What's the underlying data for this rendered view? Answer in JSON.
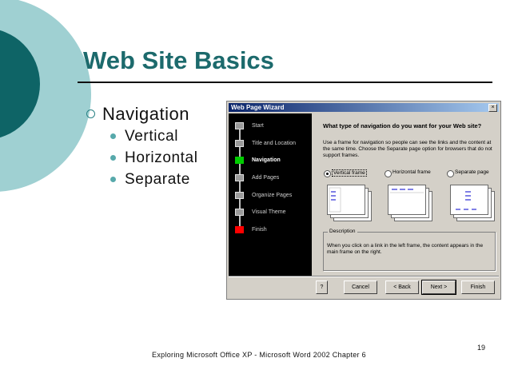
{
  "slide": {
    "title": "Web Site Basics",
    "bullet": "Navigation",
    "sub_bullets": [
      "Vertical",
      "Horizontal",
      "Separate"
    ],
    "footer": "Exploring Microsoft Office XP - Microsoft Word 2002 Chapter 6",
    "page_number": "19"
  },
  "wizard": {
    "title": "Web Page Wizard",
    "close_label": "×",
    "steps": [
      {
        "label": "Start",
        "state": "done"
      },
      {
        "label": "Title and Location",
        "state": "done"
      },
      {
        "label": "Navigation",
        "state": "current"
      },
      {
        "label": "Add Pages",
        "state": "todo"
      },
      {
        "label": "Organize Pages",
        "state": "todo"
      },
      {
        "label": "Visual Theme",
        "state": "todo"
      },
      {
        "label": "Finish",
        "state": "finish"
      }
    ],
    "question": "What type of navigation do you want for your Web site?",
    "instruction": "Use a frame for navigation so people can see the links and the content at the same time. Choose the Separate page option for browsers that do not support frames.",
    "options": [
      {
        "label": "Vertical frame",
        "selected": true
      },
      {
        "label": "Horizontal frame",
        "selected": false
      },
      {
        "label": "Separate page",
        "selected": false
      }
    ],
    "description_legend": "Description",
    "description_text": "When you click on a link in the left frame, the content appears in the main frame on the right.",
    "buttons": {
      "help": "?",
      "cancel": "Cancel",
      "back": "< Back",
      "next": "Next >",
      "finish": "Finish"
    }
  },
  "colors": {
    "title": "#1c6a6c",
    "deco_dark": "#0e6466",
    "deco_light": "#9fd0d2",
    "step_current": "#00cc00",
    "step_finish": "#ff0000"
  }
}
